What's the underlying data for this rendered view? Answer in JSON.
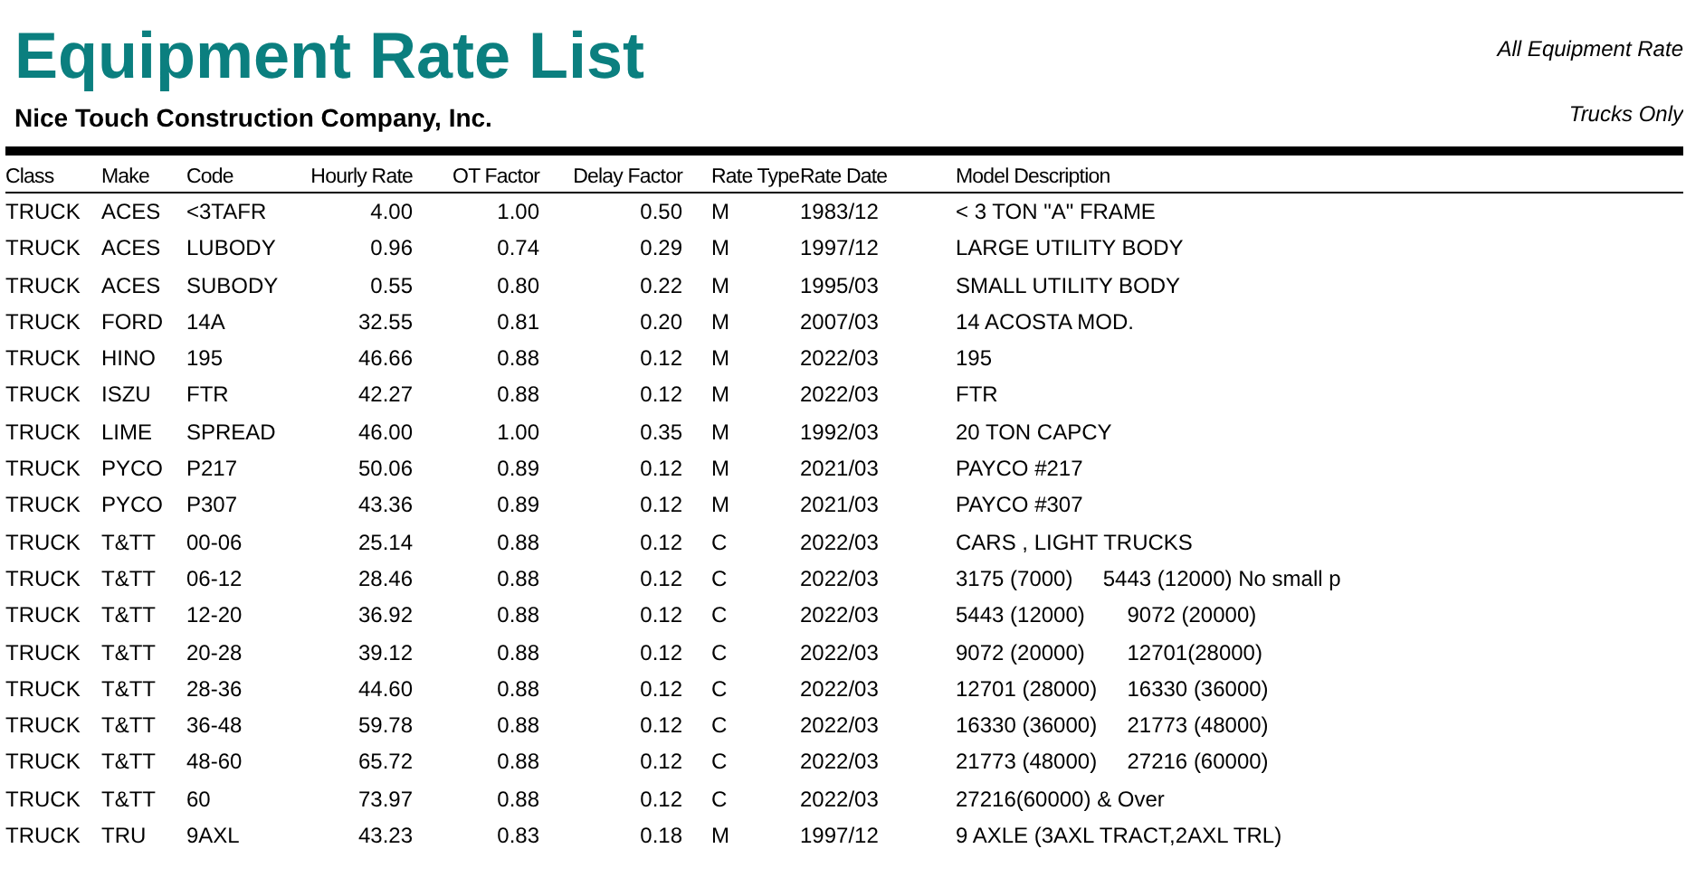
{
  "report": {
    "title": "Equipment Rate List",
    "company": "Nice Touch Construction Company, Inc.",
    "scope": "All Equipment Rate",
    "filter": "Trucks Only"
  },
  "table": {
    "columns": [
      "Class",
      "Make",
      "Code",
      "Hourly Rate",
      "OT Factor",
      "Delay Factor",
      "Rate Type",
      "Rate Date",
      "Model Description"
    ],
    "rows": [
      [
        "TRUCK",
        "ACES",
        "<3TAFR",
        "4.00",
        "1.00",
        "0.50",
        "M",
        "1983/12",
        "< 3 TON \"A\" FRAME"
      ],
      [
        "TRUCK",
        "ACES",
        "LUBODY",
        "0.96",
        "0.74",
        "0.29",
        "M",
        "1997/12",
        "LARGE UTILITY BODY"
      ],
      [
        "TRUCK",
        "ACES",
        "SUBODY",
        "0.55",
        "0.80",
        "0.22",
        "M",
        "1995/03",
        "SMALL UTILITY BODY"
      ],
      [
        "TRUCK",
        "FORD",
        "14A",
        "32.55",
        "0.81",
        "0.20",
        "M",
        "2007/03",
        "14 ACOSTA MOD."
      ],
      [
        "TRUCK",
        "HINO",
        "195",
        "46.66",
        "0.88",
        "0.12",
        "M",
        "2022/03",
        "195"
      ],
      [
        "TRUCK",
        "ISZU",
        "FTR",
        "42.27",
        "0.88",
        "0.12",
        "M",
        "2022/03",
        "FTR"
      ],
      [
        "TRUCK",
        "LIME",
        "SPREAD",
        "46.00",
        "1.00",
        "0.35",
        "M",
        "1992/03",
        "20 TON CAPCY"
      ],
      [
        "TRUCK",
        "PYCO",
        "P217",
        "50.06",
        "0.89",
        "0.12",
        "M",
        "2021/03",
        "PAYCO #217"
      ],
      [
        "TRUCK",
        "PYCO",
        "P307",
        "43.36",
        "0.89",
        "0.12",
        "M",
        "2021/03",
        "PAYCO #307"
      ],
      [
        "TRUCK",
        "T&TT",
        "00-06",
        "25.14",
        "0.88",
        "0.12",
        "C",
        "2022/03",
        "CARS , LIGHT TRUCKS"
      ],
      [
        "TRUCK",
        "T&TT",
        "06-12",
        "28.46",
        "0.88",
        "0.12",
        "C",
        "2022/03",
        "3175 (7000)     5443 (12000) No small p"
      ],
      [
        "TRUCK",
        "T&TT",
        "12-20",
        "36.92",
        "0.88",
        "0.12",
        "C",
        "2022/03",
        "5443 (12000)       9072 (20000)"
      ],
      [
        "TRUCK",
        "T&TT",
        "20-28",
        "39.12",
        "0.88",
        "0.12",
        "C",
        "2022/03",
        "9072 (20000)       12701(28000)"
      ],
      [
        "TRUCK",
        "T&TT",
        "28-36",
        "44.60",
        "0.88",
        "0.12",
        "C",
        "2022/03",
        "12701 (28000)     16330 (36000)"
      ],
      [
        "TRUCK",
        "T&TT",
        "36-48",
        "59.78",
        "0.88",
        "0.12",
        "C",
        "2022/03",
        "16330 (36000)     21773 (48000)"
      ],
      [
        "TRUCK",
        "T&TT",
        "48-60",
        "65.72",
        "0.88",
        "0.12",
        "C",
        "2022/03",
        "21773 (48000)     27216 (60000)"
      ],
      [
        "TRUCK",
        "T&TT",
        "60",
        "73.97",
        "0.88",
        "0.12",
        "C",
        "2022/03",
        "27216(60000) & Over"
      ],
      [
        "TRUCK",
        "TRU",
        "9AXL",
        "43.23",
        "0.83",
        "0.18",
        "M",
        "1997/12",
        "9 AXLE (3AXL TRACT,2AXL TRL)"
      ]
    ]
  }
}
